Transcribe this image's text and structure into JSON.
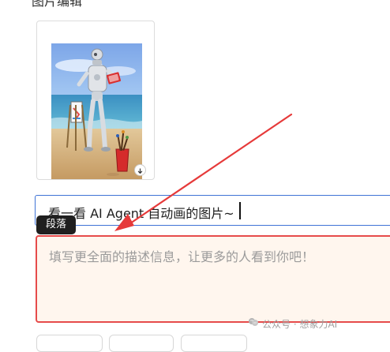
{
  "image_card": {
    "thumbnail_name": "robot-painter-image"
  },
  "title_input": {
    "value": "看一看 AI Agent 自动画的图片~"
  },
  "tooltip": {
    "label": "段落"
  },
  "description": {
    "placeholder": "填写更全面的描述信息，让更多的人看到你吧！"
  },
  "watermark": {
    "text": "公众号 · 想象力AI"
  },
  "colors": {
    "focus_border": "#3f73d6",
    "error_border": "#e64b4b",
    "annotation_arrow": "#e63a3a",
    "placeholder_text": "#9b9b9b"
  }
}
